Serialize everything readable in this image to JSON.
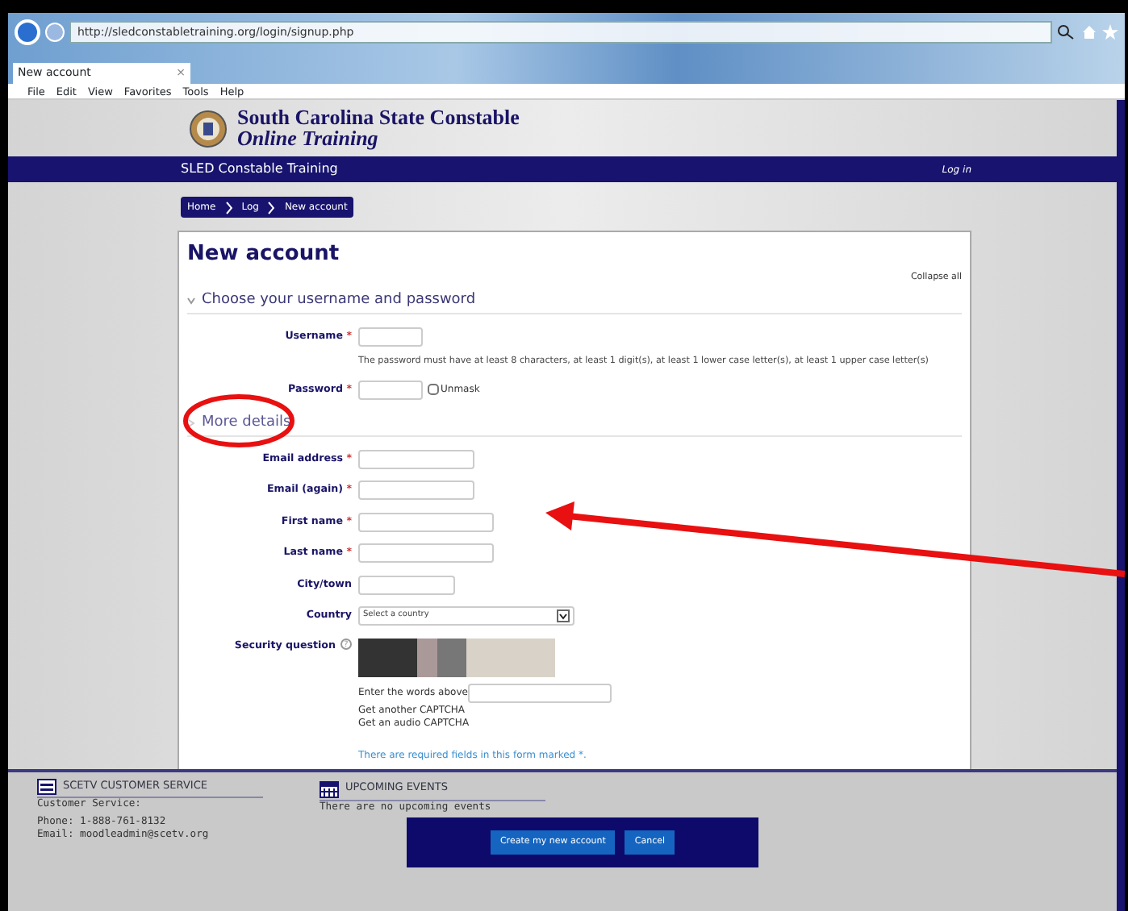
{
  "browser": {
    "address": "http://sledconstabletraining.org/login/signup.php",
    "tab_title": "New account",
    "tab_close": "×",
    "menu": [
      "File",
      "Edit",
      "View",
      "Favorites",
      "Tools",
      "Help"
    ]
  },
  "site": {
    "title": "South Carolina State Constable",
    "subtitle": "Online Training",
    "brand": "SLED Constable Training",
    "login": "Log in",
    "breadcrumb": [
      "Home",
      "Log",
      "New account"
    ]
  },
  "form": {
    "title": "New account",
    "collapse": "Collapse all",
    "sections": [
      {
        "title": "Choose your username and password",
        "expanded": true,
        "fields": [
          {
            "kind": "text",
            "label": "Username",
            "required": true
          },
          {
            "kind": "note",
            "text": "The password must have at least 8 characters, at least 1 digit(s), at least 1 lower case letter(s), at least 1 upper case letter(s)"
          },
          {
            "kind": "password",
            "label": "Password",
            "required": true,
            "unmask": {
              "label": "Unmask",
              "checked": false
            }
          }
        ]
      },
      {
        "title": "More details",
        "expanded": false,
        "fields": [
          {
            "kind": "text",
            "label": "Email address",
            "required": true
          },
          {
            "kind": "text",
            "label": "Email (again)",
            "required": true
          },
          {
            "kind": "text",
            "label": "First name",
            "required": true
          },
          {
            "kind": "text",
            "label": "Last name",
            "required": true
          },
          {
            "kind": "text",
            "label": "City/town",
            "required": false
          },
          {
            "kind": "select",
            "label": "Country",
            "value": "Select a country"
          },
          {
            "kind": "captcha",
            "label": "Security question",
            "help": "?",
            "prompt": "Enter the words above",
            "links": [
              "Get another CAPTCHA",
              "Get an audio CAPTCHA"
            ]
          }
        ]
      }
    ],
    "required_mark": "*",
    "required_note": "There are required fields in this form marked *.",
    "buttons": [
      "Create my new account",
      "Cancel"
    ]
  },
  "footer": [
    {
      "kind": "service",
      "title": "SCETV CUSTOMER SERVICE",
      "lines": [
        "Customer Service:",
        "Phone: 1-888-761-8132",
        "Email: moodleadmin@scetv.org"
      ]
    },
    {
      "kind": "events",
      "title": "UPCOMING EVENTS",
      "lines": [
        "There are no upcoming events"
      ]
    }
  ],
  "annotations": {
    "circle": true,
    "arrow": true
  }
}
